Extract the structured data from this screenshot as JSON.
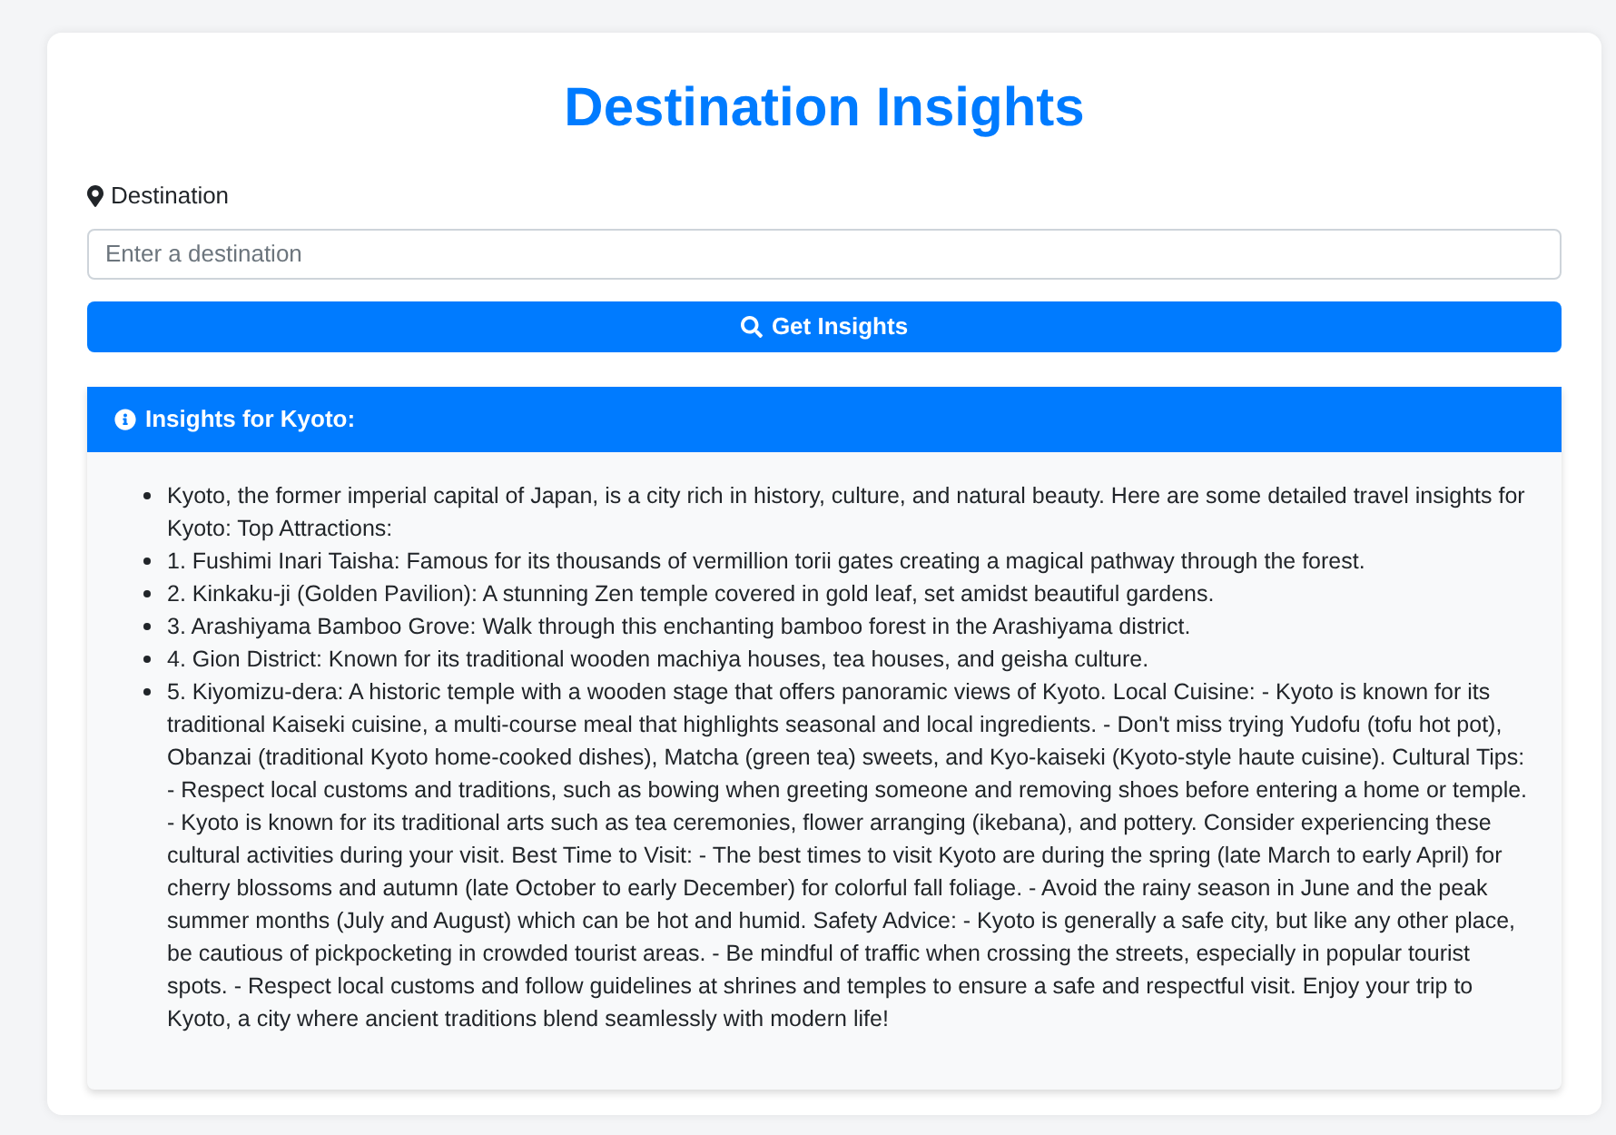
{
  "title": "Destination Insights",
  "destination": {
    "label": "Destination",
    "placeholder": "Enter a destination"
  },
  "button": {
    "label": "Get Insights"
  },
  "insights": {
    "heading": "Insights for Kyoto:",
    "items": [
      "Kyoto, the former imperial capital of Japan, is a city rich in history, culture, and natural beauty. Here are some detailed travel insights for Kyoto: Top Attractions:",
      "1. Fushimi Inari Taisha: Famous for its thousands of vermillion torii gates creating a magical pathway through the forest.",
      "2. Kinkaku-ji (Golden Pavilion): A stunning Zen temple covered in gold leaf, set amidst beautiful gardens.",
      "3. Arashiyama Bamboo Grove: Walk through this enchanting bamboo forest in the Arashiyama district.",
      "4. Gion District: Known for its traditional wooden machiya houses, tea houses, and geisha culture.",
      "5. Kiyomizu-dera: A historic temple with a wooden stage that offers panoramic views of Kyoto. Local Cuisine: - Kyoto is known for its traditional Kaiseki cuisine, a multi-course meal that highlights seasonal and local ingredients. - Don't miss trying Yudofu (tofu hot pot), Obanzai (traditional Kyoto home-cooked dishes), Matcha (green tea) sweets, and Kyo-kaiseki (Kyoto-style haute cuisine). Cultural Tips: - Respect local customs and traditions, such as bowing when greeting someone and removing shoes before entering a home or temple. - Kyoto is known for its traditional arts such as tea ceremonies, flower arranging (ikebana), and pottery. Consider experiencing these cultural activities during your visit. Best Time to Visit: - The best times to visit Kyoto are during the spring (late March to early April) for cherry blossoms and autumn (late October to early December) for colorful fall foliage. - Avoid the rainy season in June and the peak summer months (July and August) which can be hot and humid. Safety Advice: - Kyoto is generally a safe city, but like any other place, be cautious of pickpocketing in crowded tourist areas. - Be mindful of traffic when crossing the streets, especially in popular tourist spots. - Respect local customs and follow guidelines at shrines and temples to ensure a safe and respectful visit. Enjoy your trip to Kyoto, a city where ancient traditions blend seamlessly with modern life!"
    ]
  }
}
